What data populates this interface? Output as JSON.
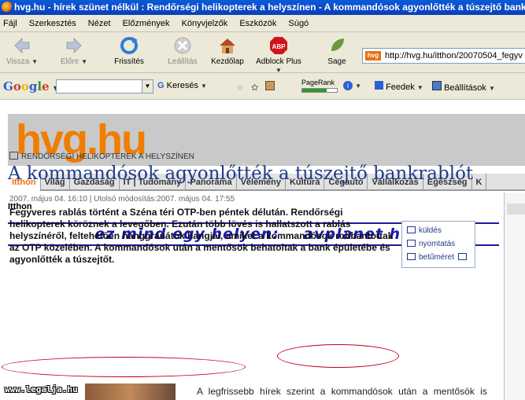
{
  "window": {
    "title": "hvg.hu - hírek szünet nélkül : Rendőrségi helikopterek a helyszínen - A kommandósok agyonlőtték a túszejtő bankrabl"
  },
  "menu": [
    "Fájl",
    "Szerkesztés",
    "Nézet",
    "Előzmények",
    "Könyvjelzők",
    "Eszközök",
    "Súgó"
  ],
  "toolbar": {
    "back": "Vissza",
    "forward": "Előre",
    "reload": "Frissítés",
    "stop": "Leállítás",
    "home": "Kezdőlap",
    "adblock": "Adblock Plus",
    "sage": "Sage",
    "url": "http://hvg.hu/itthon/20070504_fegyv"
  },
  "google_toolbar": {
    "logo": "Google",
    "search_label": "Keresés",
    "pagerank_label": "PageRank",
    "pagerank_fraction": 0.7,
    "feeds": "Feedek",
    "settings": "Beállítások"
  },
  "site": {
    "logo": "hvg.hu",
    "nav": [
      "Itthon",
      "Világ",
      "Gazdaság",
      "IT | Tudomány",
      "Panoráma",
      "Vélemény",
      "Kultúra",
      "Cégautó",
      "Vállalkozás",
      "Egészség",
      "K"
    ],
    "active_nav": "Itthon",
    "section": "Itthon",
    "banner": "ez mind egy helyen:    avplanet hu"
  },
  "article": {
    "kicker": "RENDŐRSÉGI HELIKOPTEREK A HELYSZÍNEN",
    "headline": "A kommandósok agyonlőtték a túszejtő bankrablót",
    "dateline": "2007. május 04. 16:10 | Utolsó módosítás:2007. május 04. 17:55",
    "lead": "Fegyveres rablás történt a Széna téri OTP-ben péntek délután. Rendőrségi helikopterek köröznek a levegőben. Ezután több lövés is hallatszott a rablás helyszínéről, feltehetően hanggránátok hangjai, amiket a kommandósok robbantottak az OTP közelében. A kommandósok után a mentősök behatoltak a bank épületébe és agyonlőtték a túszejtőt.",
    "tools": {
      "send": "küldés",
      "print": "nyomtatás",
      "fontsize": "betűméret"
    },
    "body_start": "A legfrissebb hírek szerint a kommandósok után a mentősök is"
  },
  "watermark": "www.legalja.hu",
  "colors": {
    "titlebar": "#0a4fc8",
    "chrome": "#ece9d8",
    "logo_orange": "#f07d00",
    "headline_blue": "#1f3a8a",
    "annotation_red": "#c0001a"
  }
}
